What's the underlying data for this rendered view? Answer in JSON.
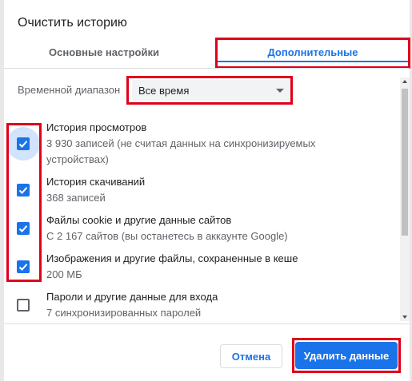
{
  "dialog": {
    "title": "Очистить историю"
  },
  "tabs": [
    {
      "label": "Основные настройки",
      "selected": false
    },
    {
      "label": "Дополнительные",
      "selected": true
    }
  ],
  "time_range": {
    "label": "Временной диапазон",
    "value": "Все время"
  },
  "items": [
    {
      "title": "История просмотров",
      "description": "3 930 записей (не считая данных на синхронизируемых устройствах)",
      "checked": true
    },
    {
      "title": "История скачиваний",
      "description": "368 записей",
      "checked": true
    },
    {
      "title": "Файлы cookie и другие данные сайтов",
      "description": "С 2 167 сайтов (вы останетесь в аккаунте Google)",
      "checked": true
    },
    {
      "title": "Изображения и другие файлы, сохраненные в кеше",
      "description": "200 МБ",
      "checked": true
    },
    {
      "title": "Пароли и другие данные для входа",
      "description": "7 синхронизированных паролей",
      "checked": false
    }
  ],
  "buttons": {
    "cancel": "Отмена",
    "delete": "Удалить данные"
  },
  "colors": {
    "accent": "#1a73e8",
    "highlight": "#e0001a"
  },
  "icons": {
    "dropdown": "chevron-down-icon",
    "checkbox_checked": "checkmark-icon"
  }
}
